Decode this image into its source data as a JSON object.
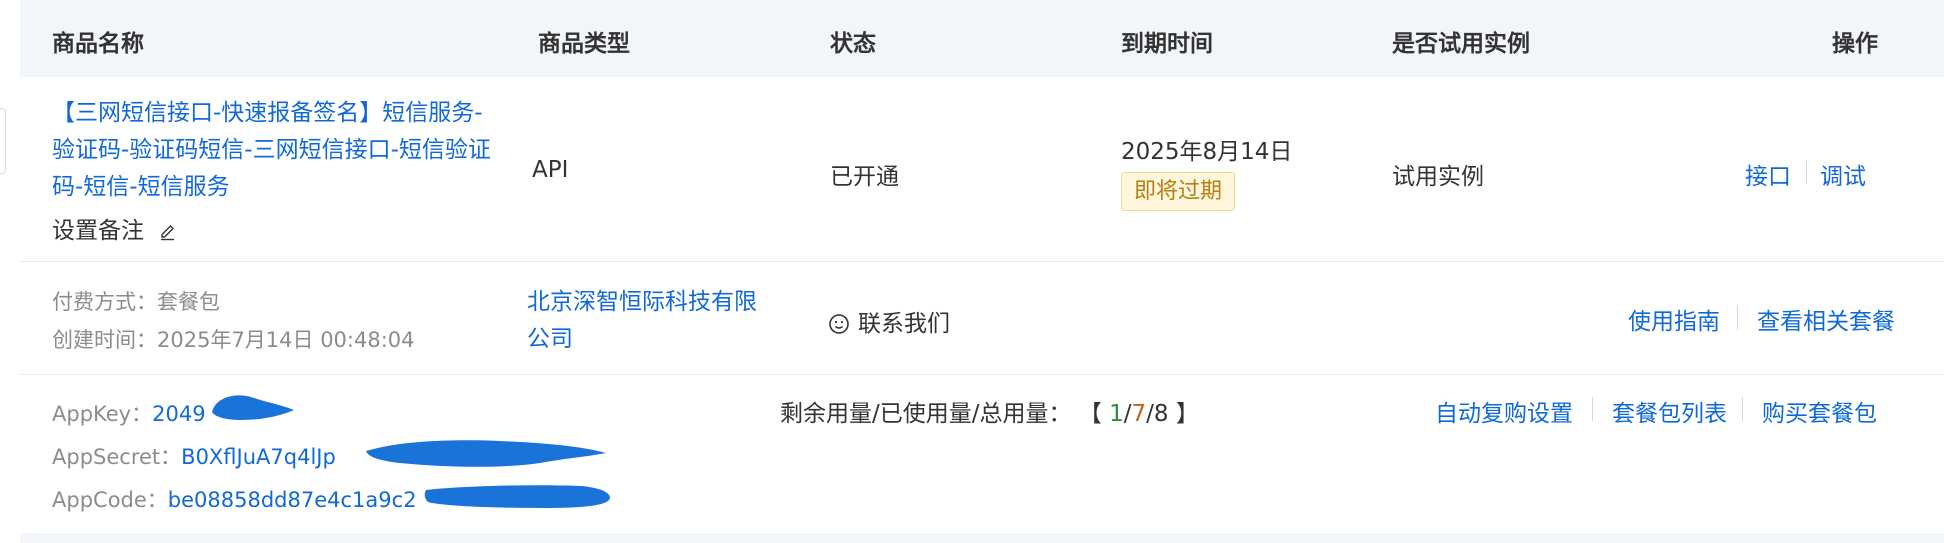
{
  "table": {
    "headers": {
      "name": "商品名称",
      "type": "商品类型",
      "status": "状态",
      "expiry": "到期时间",
      "trial": "是否试用实例",
      "actions": "操作"
    },
    "row": {
      "product_name": "【三网短信接口-快速报备签名】短信服务-验证码-验证码短信-三网短信接口-短信验证码-短信-短信服务",
      "remark_label": "设置备注",
      "product_type": "API",
      "status": "已开通",
      "expiry_date": "2025年8月14日",
      "expiry_badge": "即将过期",
      "trial": "试用实例",
      "actions": {
        "api": "接口",
        "debug": "调试"
      }
    },
    "details": {
      "payment_label": "付费方式：",
      "payment_value": "套餐包",
      "created_label": "创建时间：",
      "created_value": "2025年7月14日 00:48:04",
      "company": "北京深智恒际科技有限公司",
      "contact": "联系我们",
      "links": {
        "guide": "使用指南",
        "related": "查看相关套餐"
      }
    },
    "credentials": {
      "appkey_label": "AppKey：",
      "appkey_value": "2049",
      "appsecret_label": "AppSecret：",
      "appsecret_value": "B0XflJuA7q4lJp",
      "appcode_label": "AppCode：",
      "appcode_value": "be08858dd87e4c1a9c2",
      "usage_label": "剩余用量/已使用量/总用量：",
      "usage_open": "【 ",
      "usage_remaining": "1",
      "usage_slash1": "/",
      "usage_used": "7",
      "usage_slash2": "/",
      "usage_total": "8",
      "usage_close": " 】",
      "actions": {
        "auto_renew": "自动复购设置",
        "package_list": "套餐包列表",
        "buy": "购买套餐包"
      }
    }
  },
  "colors": {
    "link": "#1169d8",
    "header_bg": "#f2f5f9",
    "badge_bg": "#fff6db",
    "badge_text": "#b38013",
    "remaining": "#2e8b3a",
    "used": "#c0651b",
    "redaction": "#1a73d9"
  },
  "icons": {
    "remark": "pencil-icon",
    "contact": "smile-face-icon"
  }
}
